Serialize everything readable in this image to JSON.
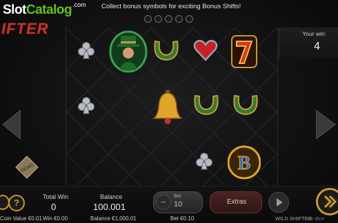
{
  "watermark": {
    "brand1": "Slot",
    "brand2": "Catalog",
    "domain": ".com"
  },
  "game_logo": "IFTER",
  "banner": "Collect bonus symbols for exciting Bonus Shifts!",
  "progress_dots": [
    0,
    0,
    0,
    0,
    0
  ],
  "your_win": {
    "label": "Your win:",
    "value": "4"
  },
  "reels": [
    [
      "club",
      "club",
      ""
    ],
    [
      "leprechaun",
      "",
      ""
    ],
    [
      "horseshoe",
      "bell",
      ""
    ],
    [
      "heart",
      "horseshoe",
      "club"
    ],
    [
      "seven",
      "horseshoe",
      "bonus-b"
    ]
  ],
  "demo_badge": "DEMO",
  "coin_value": "Coin Value €0.01",
  "total_win": {
    "label": "Total Win",
    "value": "0",
    "sub": "Win €0.00"
  },
  "balance": {
    "label": "Balance",
    "value": "100.001",
    "sub": "Balance €1,000.01"
  },
  "bet": {
    "label": "Bet",
    "value": "10",
    "sub": "Bet €0.10"
  },
  "extras_label": "Extras",
  "footer_brand": "WILD SHIFTER",
  "footer_studio": "air dice",
  "colors": {
    "accent_gold": "#c89a32",
    "green": "#2e7d32",
    "red": "#c8332a",
    "bg": "#0c0c0d"
  }
}
